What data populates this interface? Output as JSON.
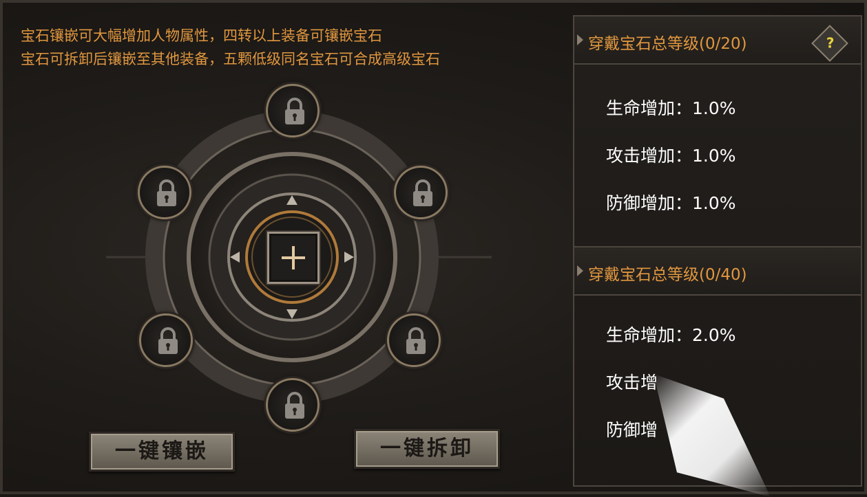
{
  "hints": {
    "line1": "宝石镶嵌可大幅增加人物属性，四转以上装备可镶嵌宝石",
    "line2": "宝石可拆卸后镶嵌至其他装备，五颗低级同名宝石可合成高级宝石"
  },
  "buttons": {
    "embed_all": "一键镶嵌",
    "remove_all": "一键拆卸"
  },
  "sections": [
    {
      "title": "穿戴宝石总等级(0/20)",
      "help": "?",
      "stats": [
        {
          "label": "生命增加：",
          "value": "1.0%"
        },
        {
          "label": "攻击增加：",
          "value": "1.0%"
        },
        {
          "label": "防御增加：",
          "value": "1.0%"
        }
      ]
    },
    {
      "title": "穿戴宝石总等级(0/40)",
      "stats": [
        {
          "label": "生命增加：",
          "value": "2.0%"
        },
        {
          "label": "攻击增",
          "value": ""
        },
        {
          "label": "防御增",
          "value": ""
        }
      ]
    }
  ],
  "colors": {
    "hint": "#e0973f",
    "title": "#e0973f",
    "stat": "#ffffff",
    "help_mark": "#e8d23c"
  },
  "icons": {
    "slot_locked": "lock-icon",
    "slot_add": "plus-icon",
    "help": "question-icon"
  }
}
